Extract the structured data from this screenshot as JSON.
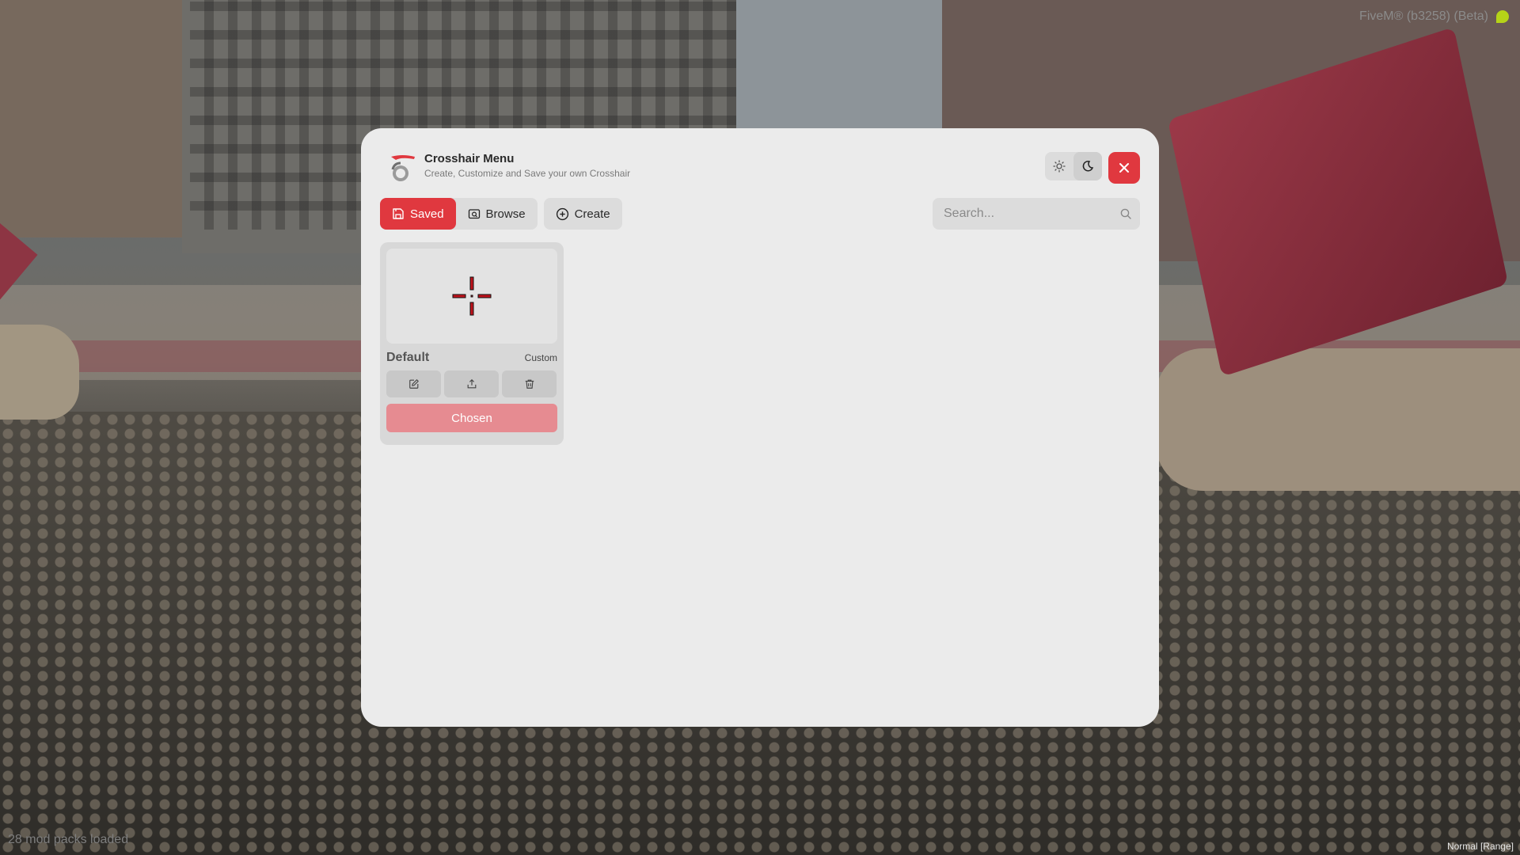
{
  "overlay": {
    "client_label": "FiveM® (b3258) (Beta)",
    "mods_label": "28 mod packs loaded",
    "mode_label": "Normal [Range]"
  },
  "header": {
    "title": "Crosshair Menu",
    "subtitle": "Create, Customize and Save your own Crosshair"
  },
  "tabs": [
    {
      "label": "Saved",
      "icon": "save-icon",
      "active": true
    },
    {
      "label": "Browse",
      "icon": "browse-icon",
      "active": false
    },
    {
      "label": "Create",
      "icon": "plus-circle-icon",
      "active": false
    }
  ],
  "search": {
    "placeholder": "Search...",
    "value": ""
  },
  "crosshairs": [
    {
      "name": "Default",
      "type": "Custom",
      "status_label": "Chosen"
    }
  ],
  "colors": {
    "accent": "#e0383f",
    "accent_muted": "#e68b91",
    "panel_bg": "#ebebeb",
    "crosshair_color": "#c0131c"
  }
}
